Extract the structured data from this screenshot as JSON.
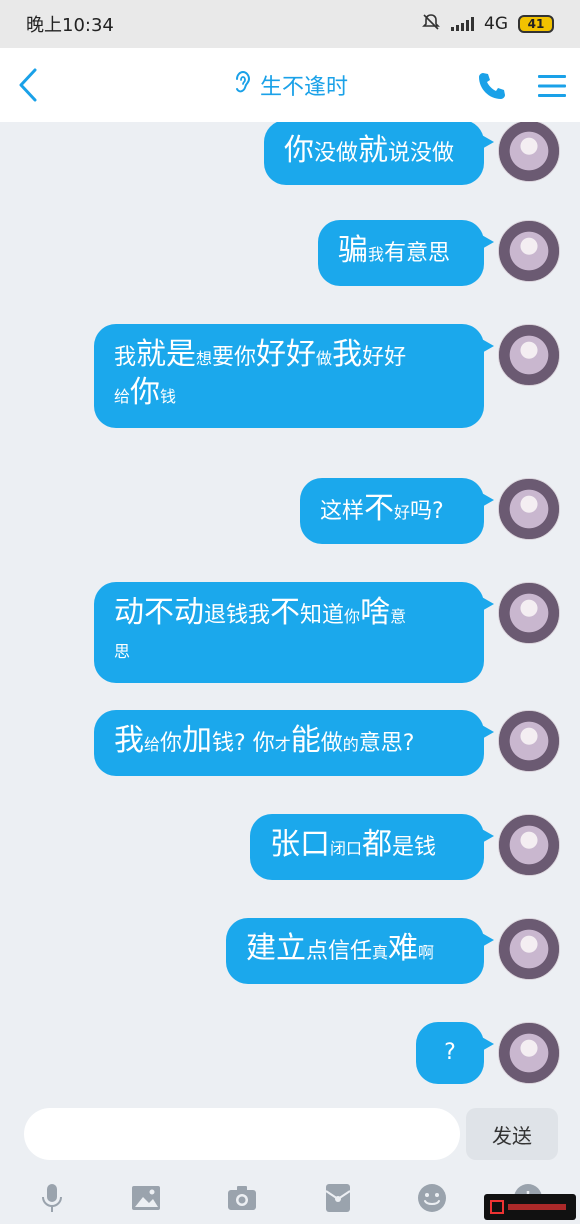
{
  "status": {
    "time": "晚上10:34",
    "network": "4G",
    "battery": "41"
  },
  "header": {
    "title": "生不逢时"
  },
  "messages": [
    {
      "parts": [
        {
          "t": "你",
          "s": "big"
        },
        {
          "t": "没做",
          "s": "n"
        },
        {
          "t": "就",
          "s": "big"
        },
        {
          "t": "说没做",
          "s": "n"
        }
      ]
    },
    {
      "parts": [
        {
          "t": "骗",
          "s": "big"
        },
        {
          "t": "我",
          "s": "sm"
        },
        {
          "t": "有意思",
          "s": "n"
        }
      ]
    },
    {
      "parts": [
        {
          "t": "我",
          "s": "n"
        },
        {
          "t": "就是",
          "s": "big"
        },
        {
          "t": "想",
          "s": "sm"
        },
        {
          "t": "要你",
          "s": "n"
        },
        {
          "t": "好好",
          "s": "big"
        },
        {
          "t": "做",
          "s": "sm"
        },
        {
          "t": "我",
          "s": "big"
        },
        {
          "t": "好好",
          "s": "n"
        },
        {
          "t": "\n",
          "s": "br"
        },
        {
          "t": "给",
          "s": "sm"
        },
        {
          "t": "你",
          "s": "big"
        },
        {
          "t": "钱",
          "s": "sm"
        }
      ]
    },
    {
      "parts": [
        {
          "t": "这样",
          "s": "n"
        },
        {
          "t": "不",
          "s": "big"
        },
        {
          "t": "好",
          "s": "sm"
        },
        {
          "t": "吗?",
          "s": "n"
        }
      ]
    },
    {
      "parts": [
        {
          "t": "动不动",
          "s": "big"
        },
        {
          "t": "退钱",
          "s": "n"
        },
        {
          "t": "我",
          "s": "n"
        },
        {
          "t": "不",
          "s": "big"
        },
        {
          "t": "知道",
          "s": "n"
        },
        {
          "t": "你",
          "s": "sm"
        },
        {
          "t": "啥",
          "s": "big"
        },
        {
          "t": "意",
          "s": "sm"
        },
        {
          "t": "\n",
          "s": "br"
        },
        {
          "t": "思",
          "s": "sm"
        }
      ]
    },
    {
      "parts": [
        {
          "t": "我",
          "s": "big"
        },
        {
          "t": "给",
          "s": "sm"
        },
        {
          "t": "你",
          "s": "n"
        },
        {
          "t": "加",
          "s": "big"
        },
        {
          "t": "钱? 你",
          "s": "n"
        },
        {
          "t": "才",
          "s": "sm"
        },
        {
          "t": "能",
          "s": "big"
        },
        {
          "t": "做",
          "s": "n"
        },
        {
          "t": "的",
          "s": "sm"
        },
        {
          "t": "意思?",
          "s": "n"
        }
      ]
    },
    {
      "parts": [
        {
          "t": "张口",
          "s": "big"
        },
        {
          "t": "闭口",
          "s": "sm"
        },
        {
          "t": "都",
          "s": "big"
        },
        {
          "t": "是钱",
          "s": "n"
        }
      ]
    },
    {
      "parts": [
        {
          "t": "建立",
          "s": "big"
        },
        {
          "t": "点信任",
          "s": "n"
        },
        {
          "t": "真",
          "s": "sm"
        },
        {
          "t": "难",
          "s": "big"
        },
        {
          "t": "啊",
          "s": "sm"
        }
      ]
    },
    {
      "parts": [
        {
          "t": "?",
          "s": "n"
        }
      ]
    }
  ],
  "composer": {
    "placeholder": "",
    "send_label": "发送"
  },
  "tools": [
    "mic-icon",
    "image-icon",
    "camera-icon",
    "red-packet-icon",
    "emoji-icon",
    "plus-icon"
  ],
  "colors": {
    "accent": "#1aa1e8",
    "bubble": "#1ba8ec",
    "background": "#eceff3"
  }
}
